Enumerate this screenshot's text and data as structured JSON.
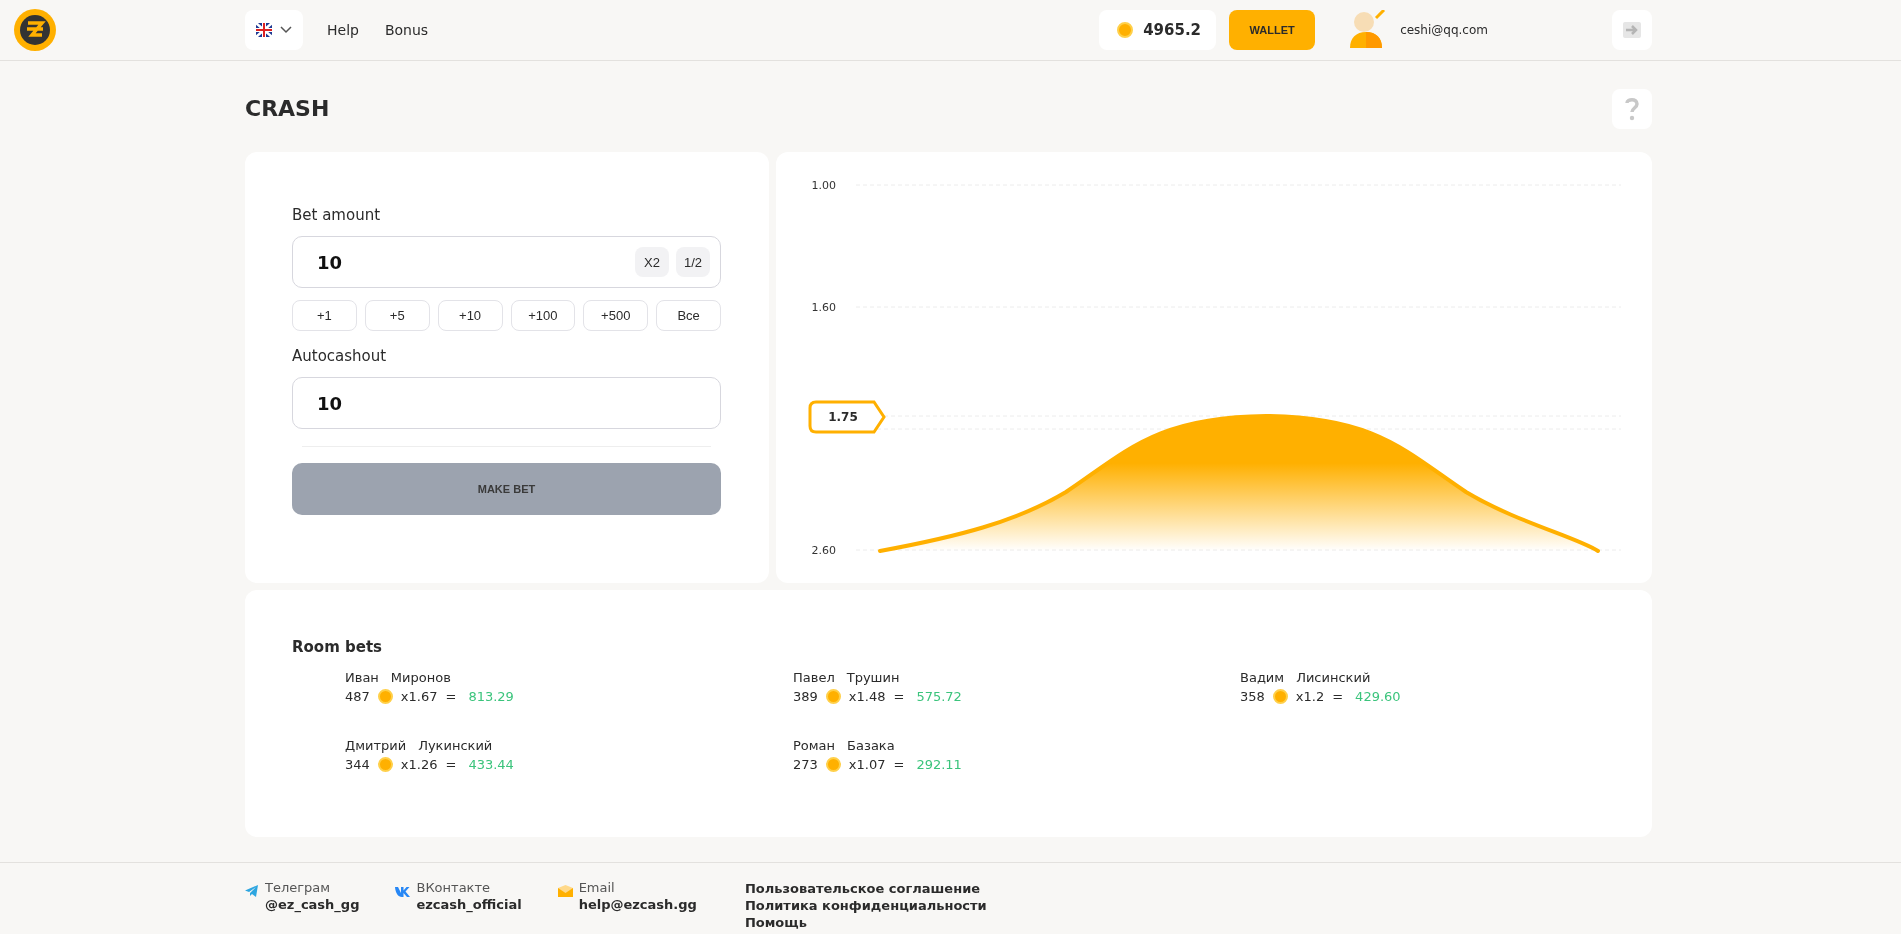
{
  "header": {
    "nav": [
      "Help",
      "Bonus"
    ],
    "balance": "4965.2",
    "wallet_button": "WALLET",
    "user_email": "ceshi@qq.com"
  },
  "page_title": "CRASH",
  "bet_form": {
    "bet_label": "Bet amount",
    "bet_value": "10",
    "multipliers": [
      "X2",
      "1/2"
    ],
    "quick_adds": [
      "+1",
      "+5",
      "+10",
      "+100",
      "+500",
      "Все"
    ],
    "autocashout_label": "Autocashout",
    "autocashout_value": "10",
    "submit": {
      "label": "MAKE BET",
      "disabled": true
    }
  },
  "graph": {
    "axis_labels": [
      "1.00",
      "1.60",
      "2.60"
    ],
    "current_multiplier": "1.75"
  },
  "room_bets": {
    "title": "Room bets",
    "bets": [
      {
        "first_name": "Иван",
        "last_name": "Миронов",
        "amount": "487",
        "multiplier": "x1.67",
        "equals": "=",
        "payout": "813.29"
      },
      {
        "first_name": "Павел",
        "last_name": "Трушин",
        "amount": "389",
        "multiplier": "x1.48",
        "equals": "=",
        "payout": "575.72"
      },
      {
        "first_name": "Вадим",
        "last_name": "Лисинский",
        "amount": "358",
        "multiplier": "x1.2",
        "equals": "=",
        "payout": "429.60"
      },
      {
        "first_name": "Дмитрий",
        "last_name": "Лукинский",
        "amount": "344",
        "multiplier": "x1.26",
        "equals": "=",
        "payout": "433.44"
      },
      {
        "first_name": "Роман",
        "last_name": "Базака",
        "amount": "273",
        "multiplier": "x1.07",
        "equals": "=",
        "payout": "292.11"
      }
    ]
  },
  "footer": {
    "contacts": [
      {
        "kind": "telegram",
        "label": "Телеграм",
        "value": "@ez_cash_gg"
      },
      {
        "kind": "vk",
        "label": "ВКонтакте",
        "value": "ezcash_official"
      },
      {
        "kind": "email",
        "label": "Email",
        "value": "help@ezcash.gg"
      }
    ],
    "links": [
      "Пользовательское соглашение",
      "Политика конфиденциальности",
      "Помощь"
    ]
  }
}
